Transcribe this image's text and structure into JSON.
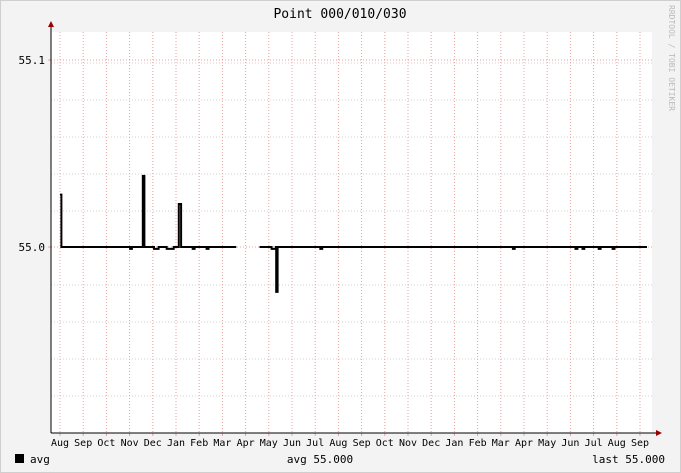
{
  "chart_data": {
    "type": "line",
    "title": "Point 000/010/030",
    "watermark": "RRDTOOL / TOBI OETIKER",
    "y_ticks": [
      {
        "value": 55.1,
        "label": "55.1"
      },
      {
        "value": 55.0,
        "label": "55.0"
      }
    ],
    "ylim": [
      54.9,
      55.1
    ],
    "x_ticks": [
      "Aug",
      "Sep",
      "Oct",
      "Nov",
      "Dec",
      "Jan",
      "Feb",
      "Mar",
      "Apr",
      "May",
      "Jun",
      "Jul",
      "Aug",
      "Sep",
      "Oct",
      "Nov",
      "Dec",
      "Jan",
      "Feb",
      "Mar",
      "Apr",
      "May",
      "Jun",
      "Jul",
      "Aug",
      "Sep"
    ],
    "series": [
      {
        "name": "avg",
        "color": "#000000",
        "segments": [
          [
            [
              0.0,
              55.028
            ],
            [
              0.05,
              55.028
            ],
            [
              0.06,
              55.0
            ],
            [
              3.0,
              55.0
            ],
            [
              3.02,
              54.999
            ],
            [
              3.1,
              55.0
            ],
            [
              3.55,
              55.0
            ],
            [
              3.57,
              55.038
            ],
            [
              3.62,
              55.038
            ],
            [
              3.64,
              55.0
            ],
            [
              4.0,
              55.0
            ],
            [
              4.05,
              54.999
            ],
            [
              4.25,
              55.0
            ],
            [
              4.6,
              54.999
            ],
            [
              4.9,
              55.0
            ],
            [
              5.1,
              55.0
            ],
            [
              5.12,
              55.023
            ],
            [
              5.2,
              55.023
            ],
            [
              5.22,
              55.0
            ],
            [
              5.7,
              55.0
            ],
            [
              5.72,
              54.999
            ],
            [
              5.8,
              55.0
            ],
            [
              6.3,
              55.0
            ],
            [
              6.32,
              54.999
            ],
            [
              6.4,
              55.0
            ],
            [
              7.6,
              55.0
            ]
          ],
          [
            [
              8.6,
              55.0
            ],
            [
              9.1,
              55.0
            ],
            [
              9.12,
              54.999
            ],
            [
              9.3,
              55.0
            ],
            [
              9.32,
              54.976
            ],
            [
              9.36,
              54.976
            ],
            [
              9.38,
              55.0
            ],
            [
              11.2,
              55.0
            ],
            [
              11.22,
              54.999
            ],
            [
              11.3,
              55.0
            ],
            [
              19.5,
              55.0
            ],
            [
              19.52,
              54.999
            ],
            [
              19.6,
              55.0
            ],
            [
              22.2,
              55.0
            ],
            [
              22.22,
              54.999
            ],
            [
              22.3,
              55.0
            ],
            [
              22.5,
              55.0
            ],
            [
              22.52,
              54.999
            ],
            [
              22.6,
              55.0
            ],
            [
              23.2,
              55.0
            ],
            [
              23.22,
              54.999
            ],
            [
              23.3,
              55.0
            ],
            [
              23.8,
              55.0
            ],
            [
              23.82,
              54.999
            ],
            [
              23.9,
              55.0
            ],
            [
              25.3,
              55.0
            ]
          ]
        ]
      }
    ],
    "legend": [
      {
        "label": "avg",
        "color": "#000000"
      }
    ],
    "summary": {
      "avg": "avg 55.000",
      "last": "last 55.000"
    },
    "grid": true,
    "colors": {
      "background": "#f3f3f3",
      "plot_background": "#ffffff",
      "grid_major": "#e8a0a0",
      "grid_minor": "#d0d0d0",
      "axis": "#000000",
      "arrow": "#990000",
      "text": "#000000",
      "watermark": "#bbbbbb"
    }
  }
}
